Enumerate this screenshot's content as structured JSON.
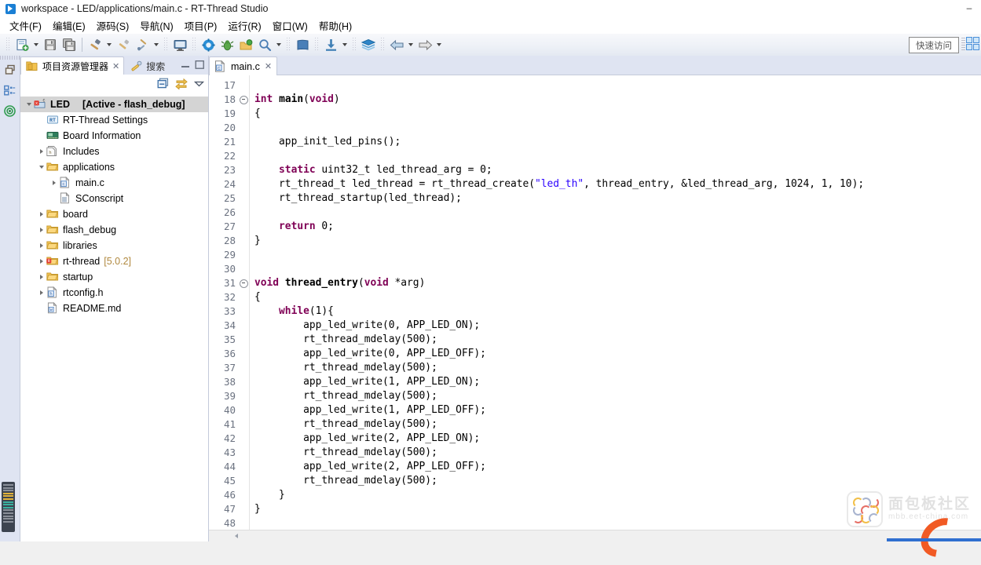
{
  "window": {
    "title": "workspace - LED/applications/main.c - RT-Thread Studio",
    "app_icon": "rt-thread-studio-icon",
    "minimize": "–",
    "maximize": "□",
    "close": "✕"
  },
  "menubar": {
    "items": [
      {
        "label": "文件(F)",
        "name": "menu-file"
      },
      {
        "label": "编辑(E)",
        "name": "menu-edit"
      },
      {
        "label": "源码(S)",
        "name": "menu-source"
      },
      {
        "label": "导航(N)",
        "name": "menu-navigate"
      },
      {
        "label": "项目(P)",
        "name": "menu-project"
      },
      {
        "label": "运行(R)",
        "name": "menu-run"
      },
      {
        "label": "窗口(W)",
        "name": "menu-window"
      },
      {
        "label": "帮助(H)",
        "name": "menu-help"
      }
    ]
  },
  "toolbar": {
    "buttons": [
      {
        "name": "new-project-icon",
        "title": "新建"
      },
      {
        "name": "save-icon",
        "title": "保存"
      },
      {
        "name": "save-all-icon",
        "title": "全部保存"
      },
      {
        "name": "build-hammer-icon",
        "title": "构建"
      },
      {
        "name": "clean-icon",
        "title": "清理"
      },
      {
        "name": "build-settings-icon",
        "title": "构建配置"
      },
      {
        "name": "terminal-icon",
        "title": "终端"
      },
      {
        "name": "settings-gear-icon",
        "title": "设置"
      },
      {
        "name": "debug-bug-icon",
        "title": "调试"
      },
      {
        "name": "run-package-icon",
        "title": "运行"
      },
      {
        "name": "search-icon",
        "title": "搜索"
      },
      {
        "name": "book-icon",
        "title": "文档"
      },
      {
        "name": "download-icon",
        "title": "下载程序"
      },
      {
        "name": "layers-icon",
        "title": "图层"
      },
      {
        "name": "back-arrow-icon",
        "title": "后退"
      },
      {
        "name": "forward-arrow-icon",
        "title": "前进"
      }
    ],
    "quick_access": "快速访问",
    "perspective_icon": "perspective-switch-icon"
  },
  "rail": {
    "items": [
      {
        "name": "restore-view-icon"
      },
      {
        "name": "outline-view-icon"
      },
      {
        "name": "target-view-icon"
      }
    ]
  },
  "explorer": {
    "tabs": [
      {
        "label": "项目资源管理器",
        "name": "tab-project-explorer",
        "icon": "project-explorer-icon",
        "active": true,
        "close": "✕"
      },
      {
        "label": "搜索",
        "name": "tab-search",
        "icon": "search-pin-icon",
        "active": false
      }
    ],
    "view_tools": [
      {
        "name": "minimize-view-icon"
      },
      {
        "name": "maximize-view-icon"
      }
    ],
    "toolbar_tools": [
      {
        "name": "collapse-all-icon"
      },
      {
        "name": "link-with-editor-icon"
      },
      {
        "name": "view-menu-icon"
      }
    ],
    "tree": [
      {
        "name": "tree-item-led",
        "label": "LED",
        "suffix": "[Active - flash_debug]",
        "icon": "project-icon",
        "indent": 0,
        "arrow": "down",
        "selected": true,
        "bold": true
      },
      {
        "name": "tree-item-rt-thread-settings",
        "label": "RT-Thread Settings",
        "suffix": "",
        "icon": "rt-settings-icon",
        "indent": 1,
        "arrow": "none",
        "selected": false,
        "bold": false
      },
      {
        "name": "tree-item-board-information",
        "label": "Board Information",
        "suffix": "",
        "icon": "board-icon",
        "indent": 1,
        "arrow": "none",
        "selected": false,
        "bold": false
      },
      {
        "name": "tree-item-includes",
        "label": "Includes",
        "suffix": "",
        "icon": "includes-icon",
        "indent": 1,
        "arrow": "right",
        "selected": false,
        "bold": false
      },
      {
        "name": "tree-item-applications",
        "label": "applications",
        "suffix": "",
        "icon": "folder-open-icon",
        "indent": 1,
        "arrow": "down",
        "selected": false,
        "bold": false
      },
      {
        "name": "tree-item-main-c",
        "label": "main.c",
        "suffix": "",
        "icon": "c-file-icon",
        "indent": 2,
        "arrow": "right",
        "selected": false,
        "bold": false
      },
      {
        "name": "tree-item-sconscript",
        "label": "SConscript",
        "suffix": "",
        "icon": "script-file-icon",
        "indent": 2,
        "arrow": "none",
        "selected": false,
        "bold": false
      },
      {
        "name": "tree-item-board",
        "label": "board",
        "suffix": "",
        "icon": "folder-icon",
        "indent": 1,
        "arrow": "right",
        "selected": false,
        "bold": false
      },
      {
        "name": "tree-item-flash-debug",
        "label": "flash_debug",
        "suffix": "",
        "icon": "folder-icon",
        "indent": 1,
        "arrow": "right",
        "selected": false,
        "bold": false
      },
      {
        "name": "tree-item-libraries",
        "label": "libraries",
        "suffix": "",
        "icon": "folder-icon",
        "indent": 1,
        "arrow": "right",
        "selected": false,
        "bold": false
      },
      {
        "name": "tree-item-rt-thread",
        "label": "rt-thread",
        "suffix": "[5.0.2]",
        "icon": "rt-folder-icon",
        "indent": 1,
        "arrow": "right",
        "selected": false,
        "bold": false
      },
      {
        "name": "tree-item-startup",
        "label": "startup",
        "suffix": "",
        "icon": "folder-icon",
        "indent": 1,
        "arrow": "right",
        "selected": false,
        "bold": false
      },
      {
        "name": "tree-item-rtconfig-h",
        "label": "rtconfig.h",
        "suffix": "",
        "icon": "h-file-icon",
        "indent": 1,
        "arrow": "right",
        "selected": false,
        "bold": false
      },
      {
        "name": "tree-item-readme-md",
        "label": "README.md",
        "suffix": "",
        "icon": "md-file-icon",
        "indent": 1,
        "arrow": "none",
        "selected": false,
        "bold": false
      }
    ]
  },
  "editor": {
    "tabs": [
      {
        "label": "main.c",
        "name": "tab-main-c",
        "icon": "c-file-icon",
        "active": true,
        "close": "✕"
      }
    ],
    "first_line": 17,
    "lines": [
      {
        "n": 17,
        "fold": false,
        "tokens": []
      },
      {
        "n": 18,
        "fold": true,
        "tokens": [
          {
            "t": "int",
            "c": "kw"
          },
          {
            "t": " ",
            "c": "pl"
          },
          {
            "t": "main",
            "c": "bold"
          },
          {
            "t": "(",
            "c": "pl"
          },
          {
            "t": "void",
            "c": "kw"
          },
          {
            "t": ")",
            "c": "pl"
          }
        ]
      },
      {
        "n": 19,
        "fold": false,
        "tokens": [
          {
            "t": "{",
            "c": "pl"
          }
        ]
      },
      {
        "n": 20,
        "fold": false,
        "tokens": []
      },
      {
        "n": 21,
        "fold": false,
        "tokens": [
          {
            "t": "    app_init_led_pins();",
            "c": "pl"
          }
        ]
      },
      {
        "n": 22,
        "fold": false,
        "tokens": []
      },
      {
        "n": 23,
        "fold": false,
        "tokens": [
          {
            "t": "    ",
            "c": "pl"
          },
          {
            "t": "static",
            "c": "kw"
          },
          {
            "t": " uint32_t led_thread_arg = 0;",
            "c": "pl"
          }
        ]
      },
      {
        "n": 24,
        "fold": false,
        "tokens": [
          {
            "t": "    rt_thread_t led_thread = rt_thread_create(",
            "c": "pl"
          },
          {
            "t": "\"led_th\"",
            "c": "str"
          },
          {
            "t": ", thread_entry, &led_thread_arg, 1024, 1, 10);",
            "c": "pl"
          }
        ]
      },
      {
        "n": 25,
        "fold": false,
        "tokens": [
          {
            "t": "    rt_thread_startup(led_thread);",
            "c": "pl"
          }
        ]
      },
      {
        "n": 26,
        "fold": false,
        "tokens": []
      },
      {
        "n": 27,
        "fold": false,
        "tokens": [
          {
            "t": "    ",
            "c": "pl"
          },
          {
            "t": "return",
            "c": "kw"
          },
          {
            "t": " 0;",
            "c": "pl"
          }
        ]
      },
      {
        "n": 28,
        "fold": false,
        "tokens": [
          {
            "t": "}",
            "c": "pl"
          }
        ]
      },
      {
        "n": 29,
        "fold": false,
        "tokens": []
      },
      {
        "n": 30,
        "fold": false,
        "tokens": []
      },
      {
        "n": 31,
        "fold": true,
        "tokens": [
          {
            "t": "void",
            "c": "kw"
          },
          {
            "t": " ",
            "c": "pl"
          },
          {
            "t": "thread_entry",
            "c": "bold"
          },
          {
            "t": "(",
            "c": "pl"
          },
          {
            "t": "void",
            "c": "kw"
          },
          {
            "t": " *arg)",
            "c": "pl"
          }
        ]
      },
      {
        "n": 32,
        "fold": false,
        "tokens": [
          {
            "t": "{",
            "c": "pl"
          }
        ]
      },
      {
        "n": 33,
        "fold": false,
        "tokens": [
          {
            "t": "    ",
            "c": "pl"
          },
          {
            "t": "while",
            "c": "kw"
          },
          {
            "t": "(1){",
            "c": "pl"
          }
        ]
      },
      {
        "n": 34,
        "fold": false,
        "tokens": [
          {
            "t": "        app_led_write(0, APP_LED_ON);",
            "c": "pl"
          }
        ]
      },
      {
        "n": 35,
        "fold": false,
        "tokens": [
          {
            "t": "        rt_thread_mdelay(500);",
            "c": "pl"
          }
        ]
      },
      {
        "n": 36,
        "fold": false,
        "tokens": [
          {
            "t": "        app_led_write(0, APP_LED_OFF);",
            "c": "pl"
          }
        ]
      },
      {
        "n": 37,
        "fold": false,
        "tokens": [
          {
            "t": "        rt_thread_mdelay(500);",
            "c": "pl"
          }
        ]
      },
      {
        "n": 38,
        "fold": false,
        "tokens": [
          {
            "t": "        app_led_write(1, APP_LED_ON);",
            "c": "pl"
          }
        ]
      },
      {
        "n": 39,
        "fold": false,
        "tokens": [
          {
            "t": "        rt_thread_mdelay(500);",
            "c": "pl"
          }
        ]
      },
      {
        "n": 40,
        "fold": false,
        "tokens": [
          {
            "t": "        app_led_write(1, APP_LED_OFF);",
            "c": "pl"
          }
        ]
      },
      {
        "n": 41,
        "fold": false,
        "tokens": [
          {
            "t": "        rt_thread_mdelay(500);",
            "c": "pl"
          }
        ]
      },
      {
        "n": 42,
        "fold": false,
        "tokens": [
          {
            "t": "        app_led_write(2, APP_LED_ON);",
            "c": "pl"
          }
        ]
      },
      {
        "n": 43,
        "fold": false,
        "tokens": [
          {
            "t": "        rt_thread_mdelay(500);",
            "c": "pl"
          }
        ]
      },
      {
        "n": 44,
        "fold": false,
        "tokens": [
          {
            "t": "        app_led_write(2, APP_LED_OFF);",
            "c": "pl"
          }
        ]
      },
      {
        "n": 45,
        "fold": false,
        "tokens": [
          {
            "t": "        rt_thread_mdelay(500);",
            "c": "pl"
          }
        ]
      },
      {
        "n": 46,
        "fold": false,
        "tokens": [
          {
            "t": "    }",
            "c": "pl"
          }
        ]
      },
      {
        "n": 47,
        "fold": false,
        "tokens": [
          {
            "t": "}",
            "c": "pl"
          }
        ]
      },
      {
        "n": 48,
        "fold": false,
        "tokens": []
      }
    ]
  },
  "watermark": {
    "title": "面包板社区",
    "url": "mbb.eet-china.com"
  },
  "colors": {
    "keyword": "#7f0055",
    "string": "#2a00ff",
    "selection": "#d4d4d4",
    "tab_bar": "#dfe4f2",
    "accent": "#2f6fd0",
    "dim_version": "#b0883e"
  }
}
